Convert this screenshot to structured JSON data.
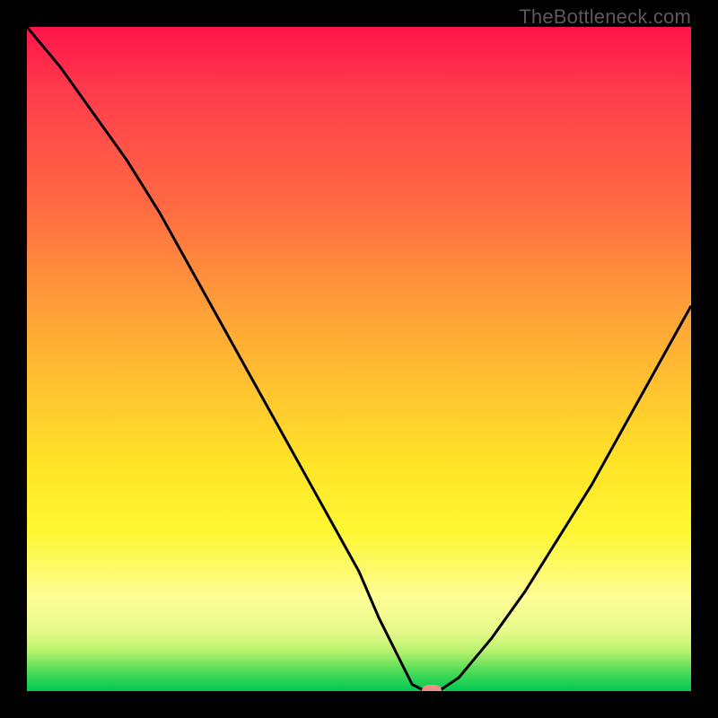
{
  "attribution": "TheBottleneck.com",
  "chart_data": {
    "type": "line",
    "title": "",
    "xlabel": "",
    "ylabel": "",
    "xlim": [
      0,
      100
    ],
    "ylim": [
      0,
      100
    ],
    "x": [
      0,
      5,
      10,
      15,
      20,
      25,
      30,
      35,
      40,
      45,
      50,
      53,
      56,
      58,
      60,
      62,
      65,
      70,
      75,
      80,
      85,
      90,
      95,
      100
    ],
    "values": [
      100,
      94,
      87,
      80,
      72,
      63,
      54,
      45,
      36,
      27,
      18,
      11,
      5,
      1,
      0,
      0,
      2,
      8,
      15,
      23,
      31,
      40,
      49,
      58
    ],
    "marker": {
      "x": 61,
      "y": 0
    },
    "gradient_stops": [
      {
        "pos": 0,
        "color": "#ff144a"
      },
      {
        "pos": 10,
        "color": "#ff3d4d"
      },
      {
        "pos": 28,
        "color": "#ff6d42"
      },
      {
        "pos": 42,
        "color": "#ff9e38"
      },
      {
        "pos": 56,
        "color": "#ffc82f"
      },
      {
        "pos": 66,
        "color": "#ffe427"
      },
      {
        "pos": 76,
        "color": "#fff733"
      },
      {
        "pos": 86,
        "color": "#fdfd96"
      },
      {
        "pos": 91,
        "color": "#e6f98a"
      },
      {
        "pos": 94,
        "color": "#b7f26d"
      },
      {
        "pos": 97,
        "color": "#4fdc58"
      },
      {
        "pos": 100,
        "color": "#00c853"
      }
    ]
  },
  "colors": {
    "frame": "#000000",
    "curve": "#000000",
    "marker": "#ef8f82",
    "attribution_text": "#5a5a5c"
  }
}
